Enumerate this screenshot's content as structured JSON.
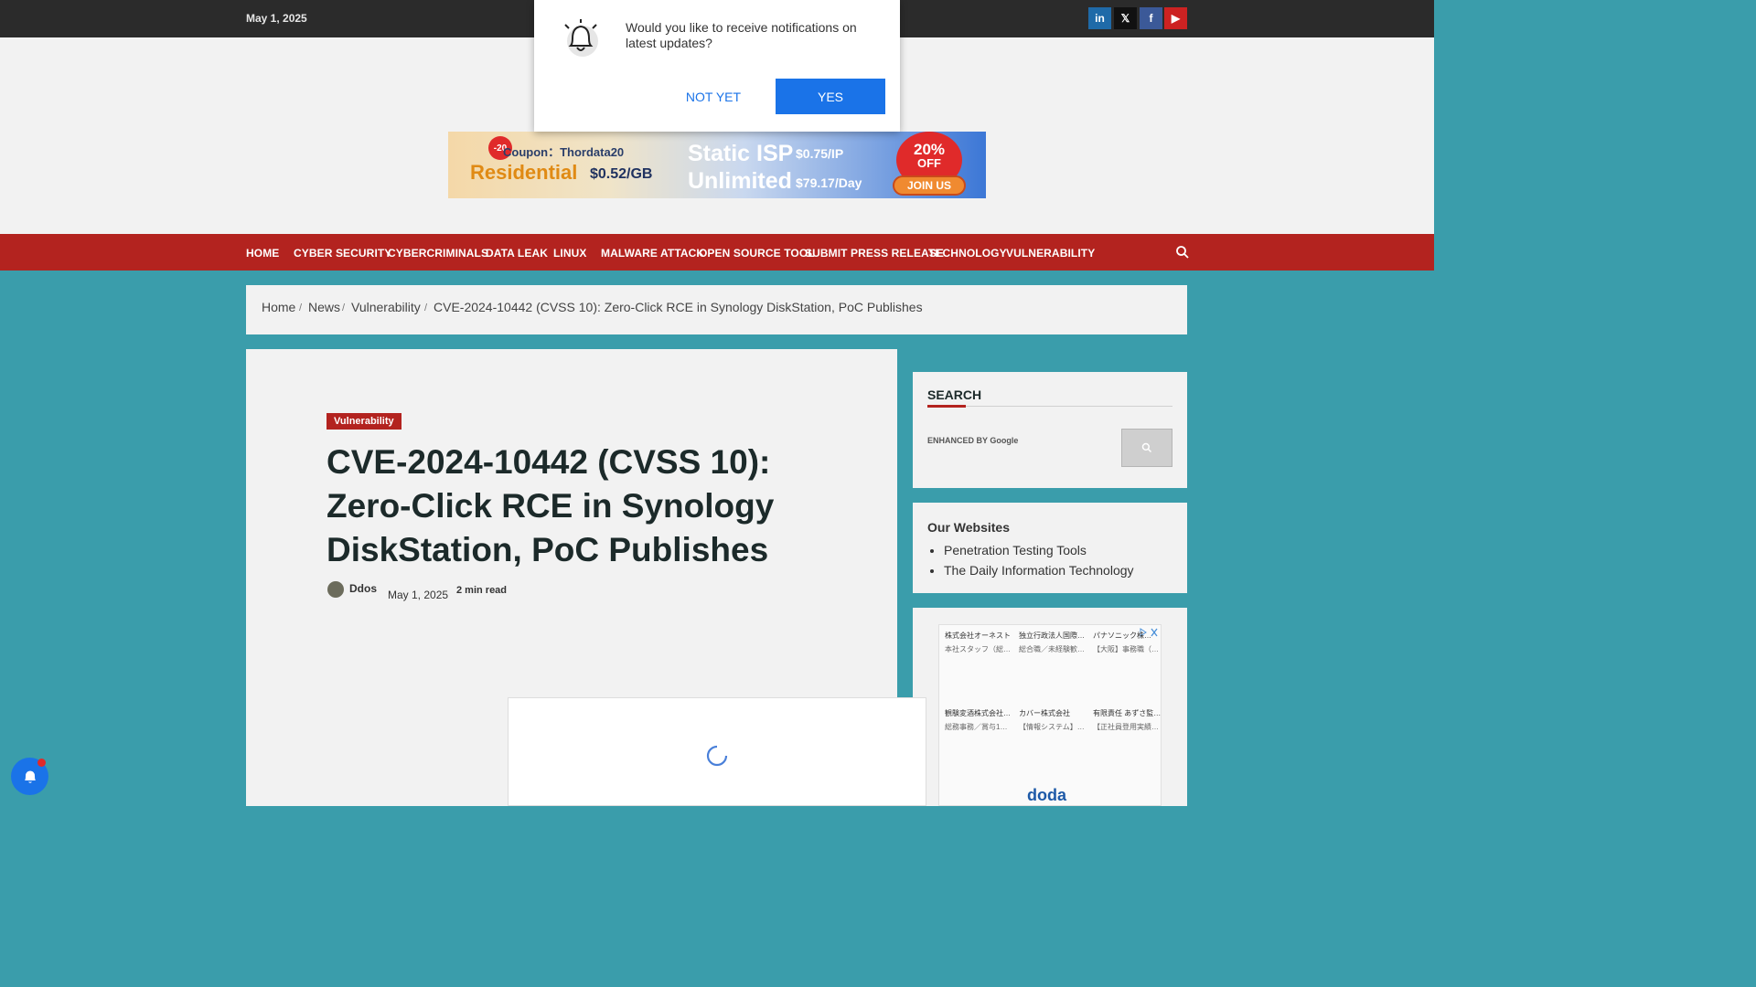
{
  "topbar": {
    "date": "May 1, 2025",
    "social": [
      {
        "name": "linkedin",
        "glyph": "in",
        "color": "#1f6aa8"
      },
      {
        "name": "x",
        "glyph": "𝕏",
        "color": "#111111"
      },
      {
        "name": "facebook",
        "glyph": "f",
        "color": "#3b5998"
      },
      {
        "name": "youtube",
        "glyph": "▶",
        "color": "#cc2222"
      }
    ]
  },
  "banner": {
    "badge": "-20",
    "coupon": "Coupon：Thordata20",
    "residential": "Residential",
    "residential_price": "$0.52/GB",
    "static": "Static ISP",
    "static_price": "$0.75/IP",
    "unlimited": "Unlimited",
    "unlimited_price": "$79.17/Day",
    "off_pct": "20%",
    "off": "OFF",
    "join": "JOIN US"
  },
  "nav": {
    "items": [
      "HOME",
      "CYBER SECURITY",
      "CYBERCRIMINALS",
      "DATA LEAK",
      "LINUX",
      "MALWARE ATTACK",
      "OPEN SOURCE TOOL",
      "SUBMIT PRESS RELEASE",
      "TECHNOLOGY",
      "VULNERABILITY"
    ]
  },
  "breadcrumb": [
    "Home",
    "News",
    "Vulnerability",
    "CVE-2024-10442 (CVSS 10): Zero-Click RCE in Synology DiskStation, PoC Publishes"
  ],
  "article": {
    "category": "Vulnerability",
    "title": "CVE-2024-10442 (CVSS 10): Zero-Click RCE in Synology DiskStation, PoC Publishes",
    "author": "Ddos",
    "date": "May 1, 2025",
    "read_time": "2 min read"
  },
  "sidebar": {
    "search_title": "SEARCH",
    "search_enhanced": "ENHANCED BY Google",
    "sites_title": "Our Websites",
    "sites": [
      "Penetration Testing Tools",
      "The Daily Information Technology"
    ],
    "ad_cells": [
      {
        "title": "株式会社オーネスト",
        "sub": "本社スタッフ（総…"
      },
      {
        "title": "独立行政法人国際…",
        "sub": "総合職／未経験歓…"
      },
      {
        "title": "パナソニック株…",
        "sub": "【大阪】事務職（…"
      },
      {
        "title": "観験変酒株式会社…",
        "sub": "総務事務／賞与1…"
      },
      {
        "title": "カバー株式会社",
        "sub": "【情報システム】…"
      },
      {
        "title": "有限責任 あずさ監…",
        "sub": "【正社員登用実績…"
      }
    ],
    "ad_brand": "doda"
  },
  "popup": {
    "message": "Would you like to receive notifications on latest updates?",
    "no": "NOT YET",
    "yes": "YES"
  }
}
